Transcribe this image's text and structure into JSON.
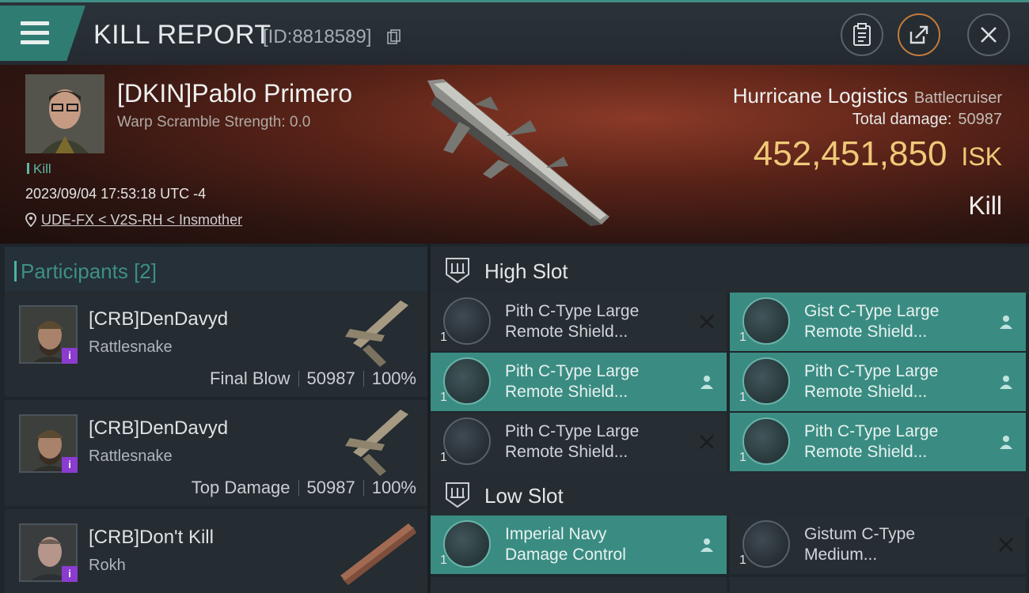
{
  "header": {
    "title": "KILL REPORT",
    "report_id": "[ID:8818589]",
    "icons": [
      "menu-icon",
      "copy-icon",
      "clipboard-icon",
      "share-icon",
      "close-icon"
    ]
  },
  "victim": {
    "name": "[DKIN]Pablo Primero",
    "warp_scramble": "Warp Scramble Strength: 0.0",
    "tag": "Kill",
    "timestamp": "2023/09/04 17:53:18 UTC -4",
    "location": "UDE-FX < V2S-RH < Insmother"
  },
  "ship": {
    "name": "Hurricane Logistics",
    "class": "Battlecruiser",
    "total_damage_label": "Total damage:",
    "total_damage": "50987",
    "isk_value": "452,451,850",
    "isk_unit": "ISK",
    "result": "Kill"
  },
  "participants": {
    "title": "Participants [2]",
    "rows": [
      {
        "name": "[CRB]DenDavyd",
        "ship": "Rattlesnake",
        "role": "Final Blow",
        "damage": "50987",
        "percent": "100%",
        "badge": "i"
      },
      {
        "name": "[CRB]DenDavyd",
        "ship": "Rattlesnake",
        "role": "Top Damage",
        "damage": "50987",
        "percent": "100%",
        "badge": "i"
      },
      {
        "name": "[CRB]Don't Kill",
        "ship": "Rokh",
        "role": "",
        "damage": "",
        "percent": "",
        "badge": "i"
      }
    ]
  },
  "slots": {
    "high": {
      "title": "High Slot",
      "modules": [
        {
          "line1": "Pith C-Type Large",
          "line2": "Remote Shield...",
          "qty": "1",
          "status": "destroyed"
        },
        {
          "line1": "Gist C-Type Large",
          "line2": "Remote Shield...",
          "qty": "1",
          "status": "dropped"
        },
        {
          "line1": "Pith C-Type Large",
          "line2": "Remote Shield...",
          "qty": "1",
          "status": "dropped"
        },
        {
          "line1": "Pith C-Type Large",
          "line2": "Remote Shield...",
          "qty": "1",
          "status": "dropped"
        },
        {
          "line1": "Pith C-Type Large",
          "line2": "Remote Shield...",
          "qty": "1",
          "status": "destroyed"
        },
        {
          "line1": "Pith C-Type Large",
          "line2": "Remote Shield...",
          "qty": "1",
          "status": "dropped"
        }
      ]
    },
    "low": {
      "title": "Low Slot",
      "modules": [
        {
          "line1": "Imperial Navy",
          "line2": "Damage Control",
          "qty": "1",
          "status": "dropped"
        },
        {
          "line1": "Gistum C-Type",
          "line2": "Medium...",
          "qty": "1",
          "status": "destroyed"
        }
      ]
    }
  },
  "colors": {
    "accent": "#3a8c82",
    "isk_gold": "#f0c978",
    "badge_purple": "#8b3ccf"
  }
}
